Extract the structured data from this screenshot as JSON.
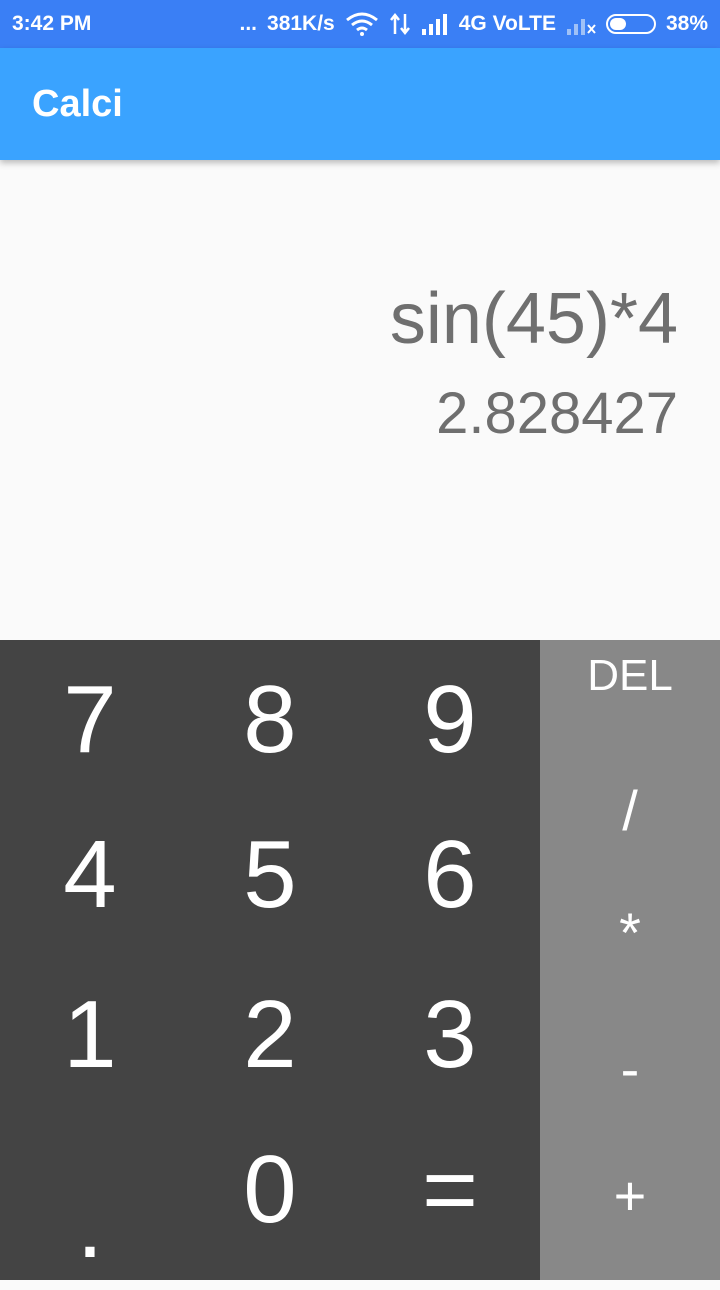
{
  "status_bar": {
    "time": "3:42 PM",
    "dots": "...",
    "speed": "381K/s",
    "network": "4G VoLTE",
    "battery": "38%",
    "battery_level": 0.38
  },
  "app_bar": {
    "title": "Calci"
  },
  "display": {
    "expression": "sin(45)*4",
    "result": "2.828427"
  },
  "keypad": {
    "keys": [
      "7",
      "8",
      "9",
      "4",
      "5",
      "6",
      "1",
      "2",
      "3",
      ".",
      "0",
      "="
    ]
  },
  "operators": {
    "del": "DEL",
    "divide": "/",
    "multiply": "*",
    "minus": "-",
    "plus": "+"
  },
  "colors": {
    "status_bar": "#3a7ff5",
    "app_bar": "#3aa3ff",
    "keypad": "#444444",
    "operator_panel": "#888888"
  }
}
